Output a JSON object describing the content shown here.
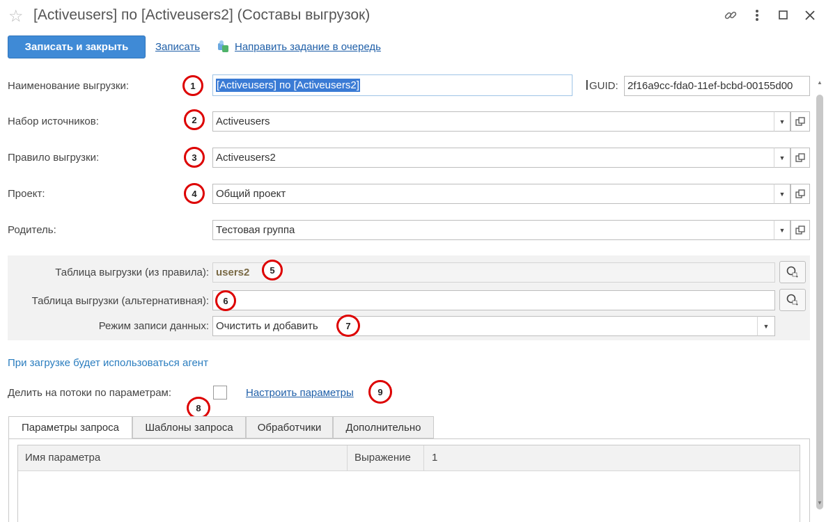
{
  "window": {
    "title": "[Activeusers] по [Activeusers2] (Составы выгрузок)",
    "icons": [
      "star-icon",
      "link-icon",
      "more-icon",
      "maximize-icon",
      "close-icon"
    ]
  },
  "toolbar": {
    "save_close_label": "Записать и закрыть",
    "save_label": "Записать",
    "queue_label": "Направить задание в очередь"
  },
  "form": {
    "name_label": "Наименование выгрузки:",
    "name_value": "[Activeusers] по [Activeusers2]",
    "guid_label": "GUID:",
    "guid_value": "2f16a9cc-fda0-11ef-bcbd-00155d00",
    "sources_label": "Набор источников:",
    "sources_value": "Activeusers",
    "rule_label": "Правило выгрузки:",
    "rule_value": "Activeusers2",
    "project_label": "Проект:",
    "project_value": "Общий проект",
    "parent_label": "Родитель:",
    "parent_value": "Тестовая группа",
    "table_rule_label": "Таблица выгрузки (из правила):",
    "table_rule_value": "users2",
    "table_alt_label": "Таблица выгрузки (альтернативная):",
    "table_alt_value": "",
    "mode_label": "Режим записи данных:",
    "mode_value": "Очистить и добавить",
    "agent_note": "При загрузке будет использоваться агент",
    "split_label": "Делить на потоки по параметрам:",
    "split_checked": false,
    "configure_link": "Настроить параметры"
  },
  "markers": [
    "1",
    "2",
    "3",
    "4",
    "5",
    "6",
    "7",
    "8",
    "9"
  ],
  "tabs": [
    {
      "label": "Параметры запроса",
      "active": true
    },
    {
      "label": "Шаблоны запроса",
      "active": false
    },
    {
      "label": "Обработчики",
      "active": false
    },
    {
      "label": "Дополнительно",
      "active": false
    }
  ],
  "params_table": {
    "columns": [
      "Имя параметра",
      "Выражение",
      "1"
    ]
  },
  "colors": {
    "primary_button": "#3f8ad6",
    "link": "#1f5fa8",
    "agent_note": "#2a7dbf",
    "marker_ring": "#dd0000",
    "selection": "#3a7bd5"
  }
}
